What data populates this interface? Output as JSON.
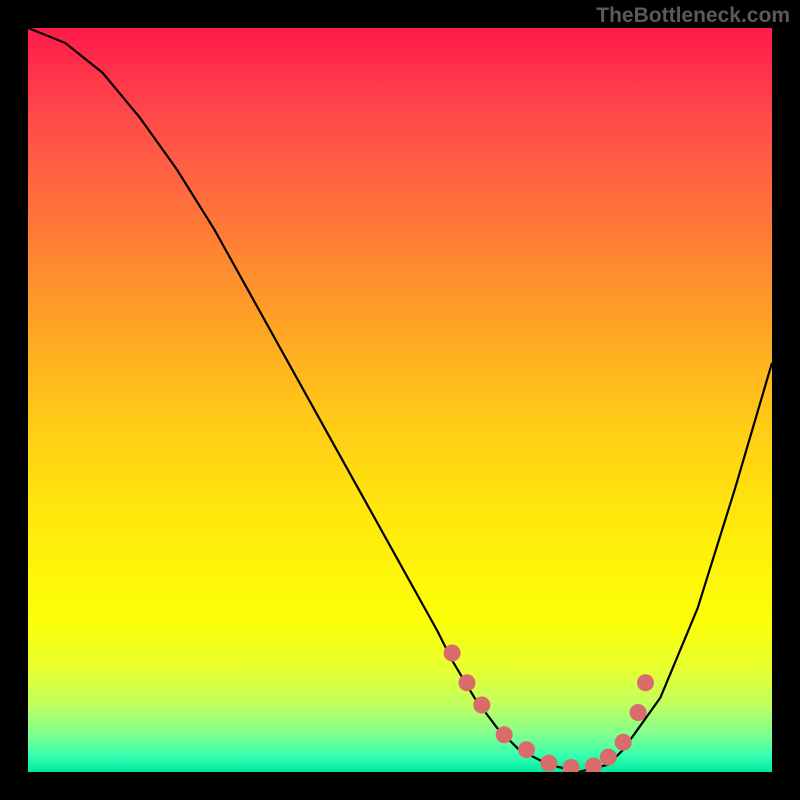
{
  "watermark": "TheBottleneck.com",
  "chart_data": {
    "type": "line",
    "title": "",
    "xlabel": "",
    "ylabel": "",
    "xlim": [
      0,
      100
    ],
    "ylim": [
      0,
      100
    ],
    "series": [
      {
        "name": "curve",
        "x": [
          0,
          5,
          10,
          15,
          20,
          25,
          30,
          35,
          40,
          45,
          50,
          55,
          57,
          60,
          63,
          66,
          70,
          74,
          78,
          80,
          85,
          90,
          95,
          100
        ],
        "y": [
          100,
          98,
          94,
          88,
          81,
          73,
          64,
          55,
          46,
          37,
          28,
          19,
          15,
          10,
          6,
          3,
          1,
          0,
          1,
          3,
          10,
          22,
          38,
          55
        ]
      }
    ],
    "markers": {
      "name": "dots",
      "x": [
        57,
        59,
        61,
        64,
        67,
        70,
        73,
        76,
        78,
        80,
        82,
        83
      ],
      "y": [
        16,
        12,
        9,
        5,
        3,
        1.2,
        0.6,
        0.8,
        2,
        4,
        8,
        12
      ]
    },
    "colors": {
      "curve": "#000000",
      "markers": "#d96b6b",
      "gradient_top": "#ff1a4a",
      "gradient_bottom": "#00e8a0"
    }
  }
}
